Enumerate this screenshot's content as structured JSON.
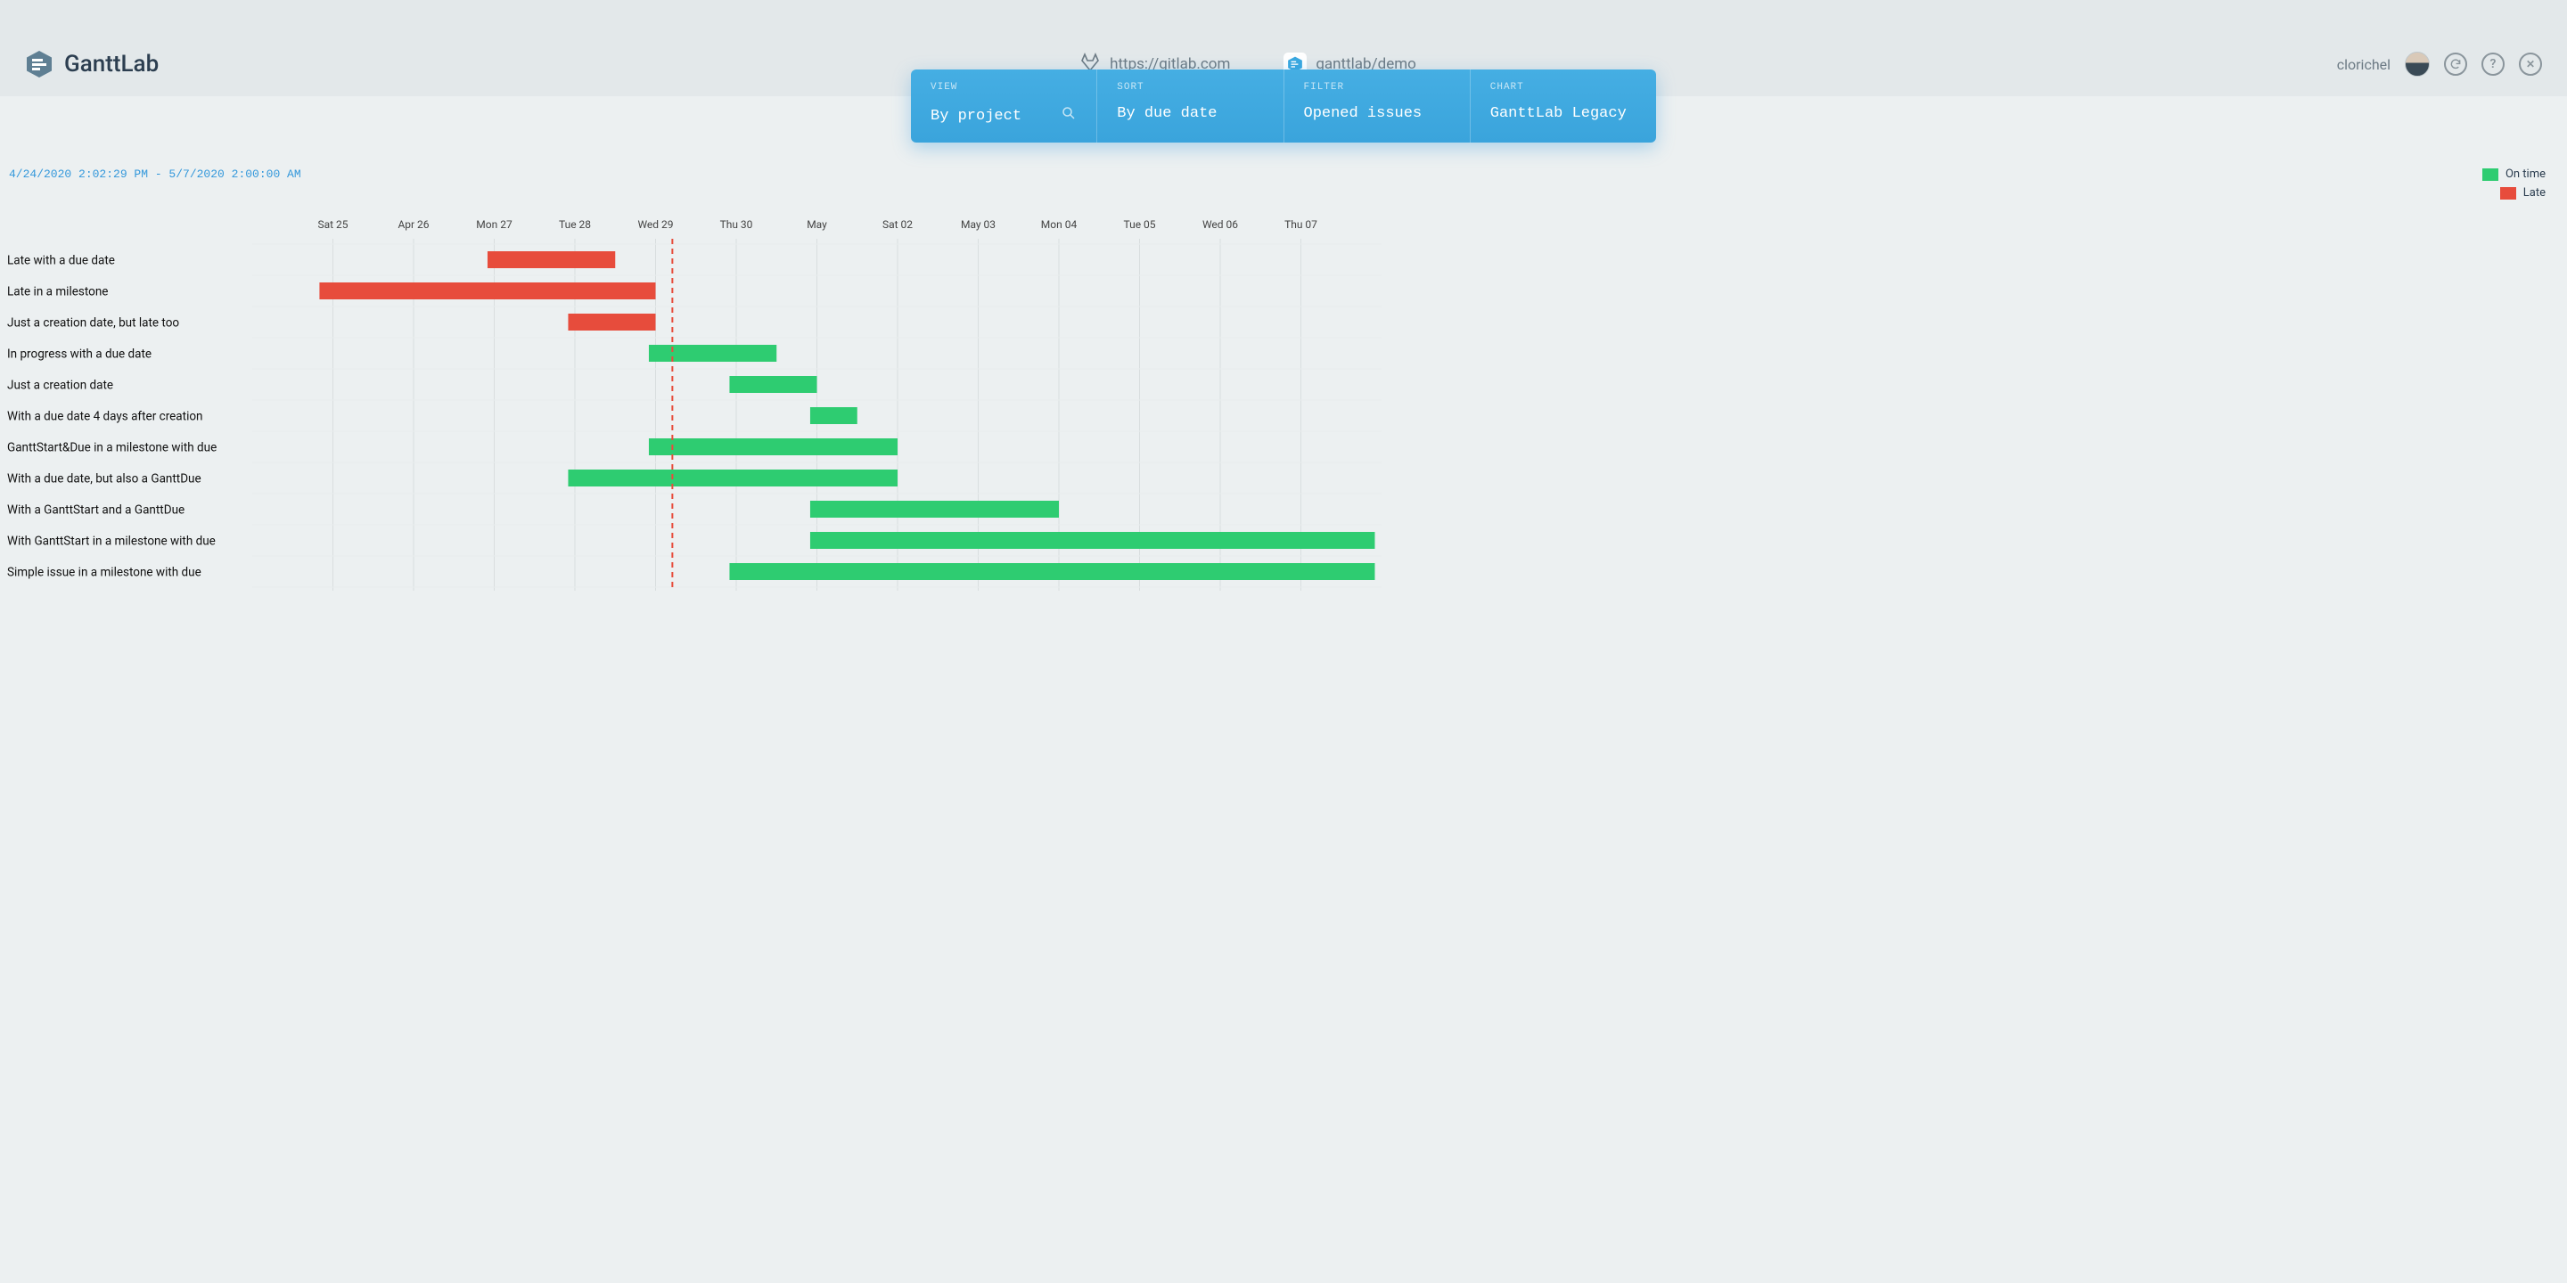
{
  "app": {
    "name": "GanttLab"
  },
  "header": {
    "gitlab_url": "https://gitlab.com",
    "project": "ganttlab/demo",
    "username": "clorichel"
  },
  "controls": {
    "view": {
      "label": "VIEW",
      "value": "By project"
    },
    "sort": {
      "label": "SORT",
      "value": "By due date"
    },
    "filter": {
      "label": "FILTER",
      "value": "Opened issues"
    },
    "chart": {
      "label": "CHART",
      "value": "GanttLab Legacy"
    }
  },
  "chart_meta": {
    "range_text": "4/24/2020 2:02:29 PM - 5/7/2020 2:00:00 AM",
    "legend": {
      "on_time": "On time",
      "late": "Late"
    },
    "colors": {
      "on_time": "#2ecc71",
      "late": "#e74c3c",
      "accent": "#3498db"
    }
  },
  "chart_data": {
    "type": "gantt",
    "xlabel": "",
    "ylabel": "",
    "x_domain": [
      "2020-04-24",
      "2020-05-08"
    ],
    "today": "2020-04-29",
    "ticks": [
      {
        "date": "2020-04-25",
        "label": "Sat 25"
      },
      {
        "date": "2020-04-26",
        "label": "Apr 26"
      },
      {
        "date": "2020-04-27",
        "label": "Mon 27"
      },
      {
        "date": "2020-04-28",
        "label": "Tue 28"
      },
      {
        "date": "2020-04-29",
        "label": "Wed 29"
      },
      {
        "date": "2020-04-30",
        "label": "Thu 30"
      },
      {
        "date": "2020-05-01",
        "label": "May"
      },
      {
        "date": "2020-05-02",
        "label": "Sat 02"
      },
      {
        "date": "2020-05-03",
        "label": "May 03"
      },
      {
        "date": "2020-05-04",
        "label": "Mon 04"
      },
      {
        "date": "2020-05-05",
        "label": "Tue 05"
      },
      {
        "date": "2020-05-06",
        "label": "Wed 06"
      },
      {
        "date": "2020-05-07",
        "label": "Thu 07"
      }
    ],
    "rows": [
      {
        "label": "Late with a due date",
        "start": "2020-04-26T22:00",
        "end": "2020-04-28T12:00",
        "status": "late"
      },
      {
        "label": "Late in a milestone",
        "start": "2020-04-24T20:00",
        "end": "2020-04-29T00:00",
        "status": "late"
      },
      {
        "label": "Just a creation date, but late too",
        "start": "2020-04-27T22:00",
        "end": "2020-04-29T00:00",
        "status": "late"
      },
      {
        "label": "In progress with a due date",
        "start": "2020-04-28T22:00",
        "end": "2020-04-30T12:00",
        "status": "on_time"
      },
      {
        "label": "Just a creation date",
        "start": "2020-04-29T22:00",
        "end": "2020-05-01T00:00",
        "status": "on_time"
      },
      {
        "label": "With a due date 4 days after creation",
        "start": "2020-04-30T22:00",
        "end": "2020-05-01T12:00",
        "status": "on_time"
      },
      {
        "label": "GanttStart&Due in a milestone with due",
        "start": "2020-04-28T22:00",
        "end": "2020-05-02T00:00",
        "status": "on_time"
      },
      {
        "label": "With a due date, but also a GanttDue",
        "start": "2020-04-27T22:00",
        "end": "2020-05-02T00:00",
        "status": "on_time"
      },
      {
        "label": "With a GanttStart and a GanttDue",
        "start": "2020-04-30T22:00",
        "end": "2020-05-04T00:00",
        "status": "on_time"
      },
      {
        "label": "With GanttStart in a milestone with due",
        "start": "2020-04-30T22:00",
        "end": "2020-05-07T22:00",
        "status": "on_time"
      },
      {
        "label": "Simple issue in a milestone with due",
        "start": "2020-04-29T22:00",
        "end": "2020-05-07T22:00",
        "status": "on_time"
      }
    ]
  }
}
